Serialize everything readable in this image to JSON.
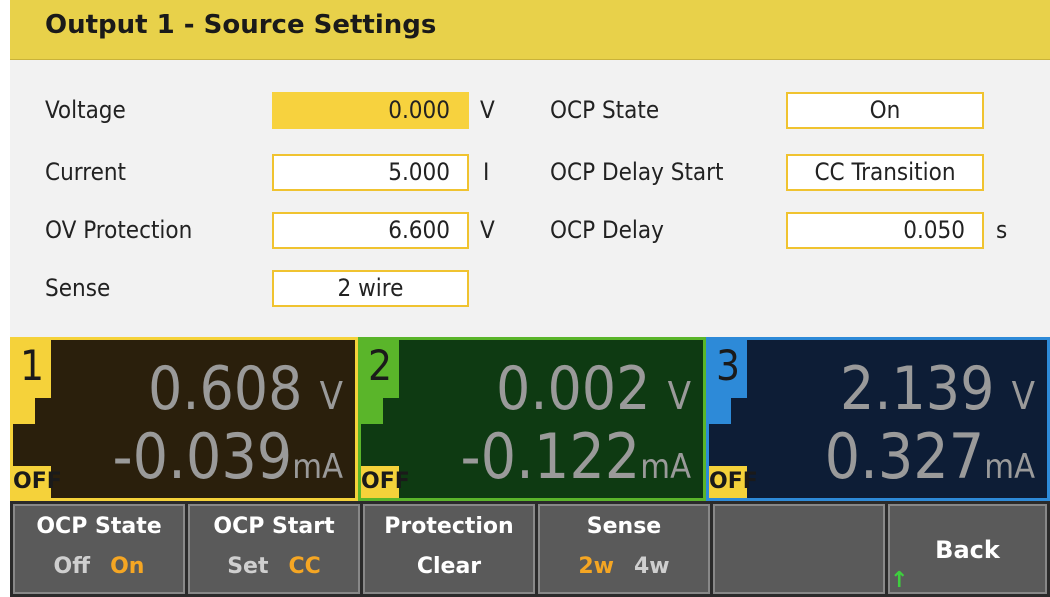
{
  "title": "Output 1 - Source Settings",
  "settings_left": [
    {
      "label": "Voltage",
      "value": "0.000",
      "unit": "V"
    },
    {
      "label": "Current",
      "value": "5.000",
      "unit": "I"
    },
    {
      "label": "OV Protection",
      "value": "6.600",
      "unit": "V"
    },
    {
      "label": "Sense",
      "value": "2 wire",
      "unit": ""
    }
  ],
  "settings_right": [
    {
      "label": "OCP State",
      "value": "On",
      "unit": ""
    },
    {
      "label": "OCP Delay Start",
      "value": "CC Transition",
      "unit": ""
    },
    {
      "label": "OCP Delay",
      "value": "0.050",
      "unit": "s"
    }
  ],
  "channels": [
    {
      "number": "1",
      "status": "OFF",
      "voltage": "0.608",
      "voltage_unit": "V",
      "current": "-0.039",
      "current_unit": "mA",
      "accent": "#f5d23a",
      "bg": "#2a1f0c"
    },
    {
      "number": "2",
      "status": "OFF",
      "voltage": "0.002",
      "voltage_unit": "V",
      "current": "-0.122",
      "current_unit": "mA",
      "accent": "#5ab52a",
      "bg": "#0e3a12"
    },
    {
      "number": "3",
      "status": "OFF",
      "voltage": "2.139",
      "voltage_unit": "V",
      "current": "0.327",
      "current_unit": "mA",
      "accent": "#2d8ad8",
      "bg": "#0d1d36"
    }
  ],
  "softkeys": {
    "ocp_state": {
      "label": "OCP State",
      "opt_a": "Off",
      "opt_b": "On"
    },
    "ocp_start": {
      "label": "OCP Start",
      "opt_a": "Set",
      "opt_b": "CC"
    },
    "protection": {
      "line1": "Protection",
      "line2": "Clear"
    },
    "sense": {
      "label": "Sense",
      "opt_a": "2w",
      "opt_b": "4w"
    },
    "back": {
      "label": "Back"
    }
  }
}
